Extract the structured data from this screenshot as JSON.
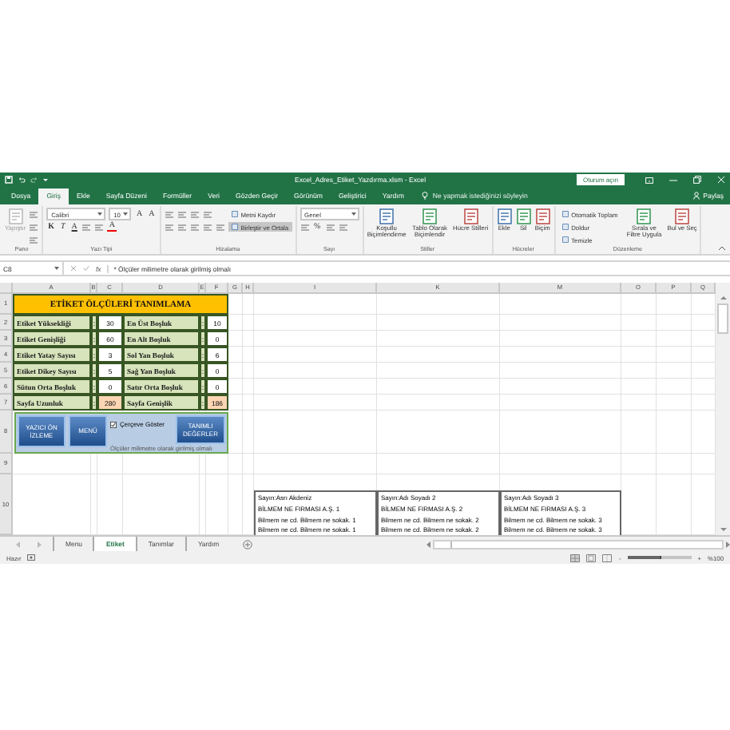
{
  "window": {
    "title": "Excel_Adres_Etiket_Yazdırma.xlsm - Excel",
    "sign_in": "Oturum açın"
  },
  "tabs": [
    {
      "label": "Dosya",
      "selected": false
    },
    {
      "label": "Giriş",
      "selected": true
    },
    {
      "label": "Ekle",
      "selected": false
    },
    {
      "label": "Sayfa Düzeni",
      "selected": false
    },
    {
      "label": "Formüller",
      "selected": false
    },
    {
      "label": "Veri",
      "selected": false
    },
    {
      "label": "Gözden Geçir",
      "selected": false
    },
    {
      "label": "Görünüm",
      "selected": false
    },
    {
      "label": "Geliştirici",
      "selected": false
    },
    {
      "label": "Yardım",
      "selected": false
    }
  ],
  "search": {
    "placeholder": "Ne yapmak istediğinizi söyleyin"
  },
  "share": "Paylaş",
  "ribbon": [
    {
      "label": "Pano",
      "parts": [
        {
          "kind": "large",
          "text": "Yapıştır",
          "disabled": true
        },
        {
          "kind": "stack",
          "lines": [
            [
              {
                "kind": "icon"
              }
            ],
            [
              {
                "kind": "icon"
              }
            ],
            [
              {
                "kind": "icon"
              }
            ]
          ]
        }
      ]
    },
    {
      "label": "Yazı Tipi",
      "parts": [
        {
          "kind": "stack",
          "lines": [
            [
              {
                "kind": "combo",
                "text": "Calibri"
              },
              {
                "kind": "combo",
                "text": "10"
              },
              {
                "kind": "letter",
                "text": "A"
              },
              {
                "kind": "letter",
                "text": "A"
              }
            ],
            [
              {
                "kind": "bold",
                "text": "K"
              },
              {
                "kind": "italic",
                "text": "T"
              },
              {
                "kind": "underline",
                "text": "A"
              },
              {
                "kind": "icon"
              },
              {
                "kind": "icon"
              },
              {
                "kind": "font-color",
                "text": "A"
              }
            ]
          ]
        }
      ]
    },
    {
      "label": "Hizalama",
      "parts": [
        {
          "kind": "stack",
          "lines": [
            [
              {
                "kind": "icon"
              },
              {
                "kind": "icon"
              },
              {
                "kind": "icon"
              },
              {
                "kind": "icon"
              }
            ],
            [
              {
                "kind": "icon"
              },
              {
                "kind": "icon"
              },
              {
                "kind": "icon"
              },
              {
                "kind": "icon"
              },
              {
                "kind": "icon"
              }
            ]
          ]
        },
        {
          "kind": "stack",
          "lines": [
            [
              {
                "kind": "text",
                "text": "Metni Kaydır",
                "on": false
              }
            ],
            [
              {
                "kind": "text",
                "text": "Birleştir ve Ortala",
                "on": true
              }
            ]
          ]
        }
      ]
    },
    {
      "label": "Sayı",
      "parts": [
        {
          "kind": "stack",
          "lines": [
            [
              {
                "kind": "combo",
                "text": "Genel"
              }
            ],
            [
              {
                "kind": "icon"
              },
              {
                "kind": "letter",
                "text": "%"
              },
              {
                "kind": "icon"
              },
              {
                "kind": "icon"
              }
            ]
          ]
        }
      ]
    },
    {
      "label": "Stiller",
      "parts": [
        {
          "kind": "large",
          "text": "Koşullu Biçimlendirme",
          "disabled": false
        },
        {
          "kind": "large",
          "text": "Tablo Olarak Biçimlendir",
          "disabled": false
        },
        {
          "kind": "large",
          "text": "Hücre Stilleri",
          "disabled": false
        }
      ]
    },
    {
      "label": "Hücreler",
      "parts": [
        {
          "kind": "large",
          "text": "Ekle",
          "disabled": false
        },
        {
          "kind": "large",
          "text": "Sil",
          "disabled": false
        },
        {
          "kind": "large",
          "text": "Biçim",
          "disabled": false
        }
      ]
    },
    {
      "label": "Düzenleme",
      "parts": [
        {
          "kind": "stack",
          "lines": [
            [
              {
                "kind": "text",
                "text": "Otomatik Toplam",
                "on": false
              }
            ],
            [
              {
                "kind": "text",
                "text": "Doldur",
                "on": false
              }
            ],
            [
              {
                "kind": "text",
                "text": "Temizle",
                "on": false
              }
            ]
          ]
        },
        {
          "kind": "large",
          "text": "Sırala ve Filtre Uygula",
          "disabled": false
        },
        {
          "kind": "large",
          "text": "Bul ve Seç",
          "disabled": false
        }
      ]
    }
  ],
  "formula_bar": {
    "name_box": "C8",
    "function_label": "fx",
    "content": "* Ölçüler milimetre olarak girilmiş olmalı"
  },
  "columns": [
    "A",
    "B",
    "C",
    "D",
    "E",
    "F",
    "G",
    "H",
    "I",
    "K",
    "M",
    "O",
    "P",
    "Q"
  ],
  "row_numbers": [
    "1",
    "2",
    "3",
    "4",
    "5",
    "6",
    "7",
    "8",
    "9",
    "10"
  ],
  "table": {
    "title": "ETİKET ÖLÇÜLERİ TANIMLAMA",
    "rows": [
      {
        "label_1": "Etiket Yüksekliği",
        "colon_1": ":",
        "value_1": "30",
        "label_2": "En Üst Boşluk",
        "colon_2": ":",
        "value_2": "10",
        "highlight": false
      },
      {
        "label_1": "Etiket Genişliği",
        "colon_1": ":",
        "value_1": "60",
        "label_2": "En Alt Boşluk",
        "colon_2": ":",
        "value_2": "0",
        "highlight": false
      },
      {
        "label_1": "Etiket Yatay Sayısı",
        "colon_1": ":",
        "value_1": "3",
        "label_2": "Sol Yan Boşluk",
        "colon_2": ":",
        "value_2": "6",
        "highlight": false
      },
      {
        "label_1": "Etiket Dikey Sayısı",
        "colon_1": ":",
        "value_1": "5",
        "label_2": "Sağ Yan Boşluk",
        "colon_2": ":",
        "value_2": "0",
        "highlight": false
      },
      {
        "label_1": "Sütun Orta Boşluk",
        "colon_1": ":",
        "value_1": "0",
        "label_2": "Satır Orta Boşluk",
        "colon_2": ":",
        "value_2": "0",
        "highlight": false
      },
      {
        "label_1": "Sayfa Uzunluk",
        "colon_1": ":",
        "value_1": "280",
        "label_2": "Sayfa Genişlik",
        "colon_2": ":",
        "value_2": "186",
        "highlight": true
      }
    ]
  },
  "form": {
    "buttons": [
      "YAZICI ÖN İZLEME",
      "MENÜ",
      "TANIMLI DEĞERLER"
    ],
    "checkbox": {
      "label": "Çerçeve Göster",
      "checked": true
    },
    "note": "Ölçüler milimetre olarak girilmiş olmalı"
  },
  "labels": [
    {
      "lines": [
        "Sayın:Asrı Akdeniz",
        "BİLMEM NE FIRMASI A.Ş. 1",
        "Bilmem ne cd. Bilmem ne sokak. 1",
        "Bilmem ne cd. Bilmem ne sokak. 1"
      ]
    },
    {
      "lines": [
        "Sayın:Adı Soyadı 2",
        "BİLMEM NE FIRMASI A.Ş. 2",
        "Bilmem ne cd. Bilmem ne sokak. 2",
        "Bilmem ne cd. Bilmem ne sokak. 2"
      ]
    },
    {
      "lines": [
        "Sayın:Adı Soyadı 3",
        "BİLMEM NE FIRMASI A.Ş. 3",
        "Bilmem ne cd. Bilmem ne sokak. 3",
        "Bilmem ne cd. Bilmem ne sokak. 3"
      ]
    }
  ],
  "sheet_tabs": [
    {
      "label": "Menu",
      "selected": false
    },
    {
      "label": "Etiket",
      "selected": true
    },
    {
      "label": "Tanımlar",
      "selected": false
    },
    {
      "label": "Yardım",
      "selected": false
    }
  ],
  "status": {
    "text": "Hazır",
    "zoom_out": "-",
    "zoom_in": "+",
    "zoom": {
      "level": 0.5,
      "reading": "%100"
    }
  }
}
